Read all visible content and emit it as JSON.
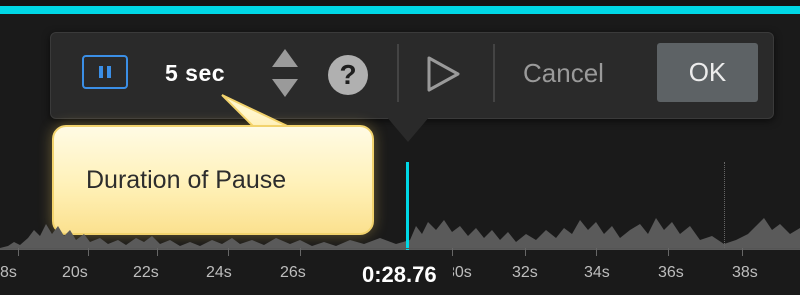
{
  "popup": {
    "duration_label": "5 sec",
    "help_icon": "?",
    "cancel_label": "Cancel",
    "ok_label": "OK"
  },
  "tooltip": {
    "text": "Duration of Pause"
  },
  "timeline": {
    "current_time": "0:28.76",
    "ticks": [
      "8s",
      "20s",
      "22s",
      "24s",
      "26s",
      "30s",
      "32s",
      "34s",
      "36s",
      "38s"
    ]
  },
  "colors": {
    "accent": "#00d8e6",
    "pause_icon": "#3b8fe6",
    "ok_button": "#5d6265",
    "tooltip_bg": "#fff1b8"
  },
  "icons": {
    "pause": "pause-icon",
    "stepper": "up-down-stepper-icon",
    "help": "question-icon",
    "play": "play-icon"
  }
}
